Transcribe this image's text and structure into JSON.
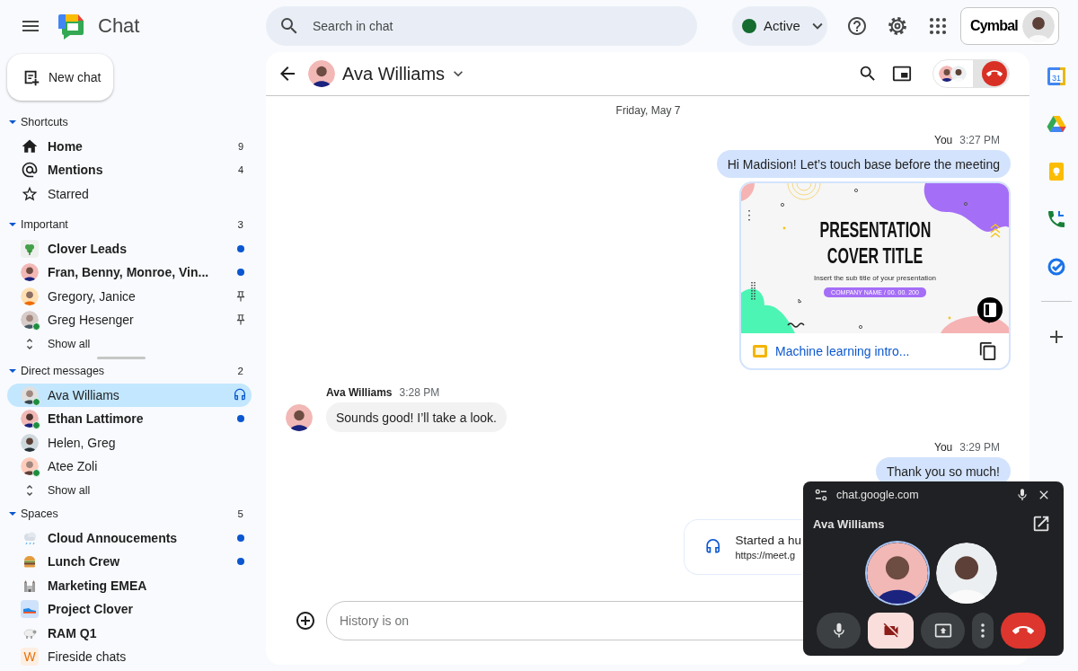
{
  "app": {
    "title": "Chat"
  },
  "search": {
    "placeholder": "Search in chat"
  },
  "status": {
    "label": "Active"
  },
  "account": {
    "brand": "Cymbal"
  },
  "new_chat": {
    "label": "New chat"
  },
  "sidebar": {
    "sections": [
      {
        "title": "Shortcuts",
        "expanded": true,
        "items": [
          {
            "kind": "home",
            "label": "Home",
            "unread": true,
            "count": "9",
            "notification": false,
            "pinned": false,
            "in_call": false,
            "online": false,
            "selected": false
          },
          {
            "kind": "mention",
            "label": "Mentions",
            "unread": true,
            "count": "4",
            "notification": false,
            "pinned": false,
            "in_call": false,
            "online": false,
            "selected": false
          },
          {
            "kind": "starred",
            "label": "Starred",
            "unread": false,
            "notification": false,
            "pinned": false,
            "in_call": false,
            "online": false,
            "selected": false
          }
        ]
      },
      {
        "title": "Important",
        "count": "3",
        "expanded": true,
        "items": [
          {
            "kind": "clover",
            "label": "Clover Leads",
            "unread": true,
            "notification": true,
            "pinned": false,
            "in_call": false,
            "online": false,
            "selected": false
          },
          {
            "kind": "person",
            "label": "Fran, Benny, Monroe, Vin...",
            "unread": true,
            "notification": true,
            "pinned": false,
            "in_call": false,
            "online": false,
            "selected": false
          },
          {
            "kind": "person",
            "label": "Gregory, Janice",
            "unread": false,
            "notification": false,
            "pinned": true,
            "in_call": false,
            "online": false,
            "selected": false
          },
          {
            "kind": "person",
            "label": "Greg Hesenger",
            "unread": false,
            "notification": false,
            "pinned": true,
            "in_call": false,
            "online": true,
            "selected": false
          },
          {
            "kind": "show_all",
            "label": "Show all"
          }
        ]
      },
      {
        "title": "Direct messages",
        "count": "2",
        "expanded": true,
        "items": [
          {
            "kind": "person",
            "label": "Ava Williams",
            "unread": false,
            "notification": false,
            "pinned": false,
            "in_call": true,
            "online": true,
            "selected": true
          },
          {
            "kind": "person",
            "label": "Ethan Lattimore",
            "unread": true,
            "notification": true,
            "pinned": false,
            "in_call": false,
            "online": true,
            "selected": false
          },
          {
            "kind": "person",
            "label": "Helen, Greg",
            "unread": false,
            "notification": false,
            "pinned": false,
            "in_call": false,
            "online": false,
            "selected": false
          },
          {
            "kind": "person",
            "label": "Atee Zoli",
            "unread": false,
            "notification": false,
            "pinned": false,
            "in_call": false,
            "online": true,
            "selected": false
          },
          {
            "kind": "show_all",
            "label": "Show all"
          }
        ]
      },
      {
        "title": "Spaces",
        "count": "5",
        "expanded": true,
        "items": [
          {
            "kind": "cloud",
            "label": "Cloud Annoucements",
            "unread": true,
            "notification": true,
            "pinned": false,
            "in_call": false,
            "online": false,
            "selected": false
          },
          {
            "kind": "burger",
            "label": "Lunch Crew",
            "unread": true,
            "notification": true,
            "pinned": false,
            "in_call": false,
            "online": false,
            "selected": false
          },
          {
            "kind": "castle",
            "label": "Marketing EMEA",
            "unread": true,
            "notification": false,
            "pinned": false,
            "in_call": false,
            "online": false,
            "selected": false
          },
          {
            "kind": "shoe",
            "label": "Project Clover",
            "unread": true,
            "notification": false,
            "pinned": false,
            "in_call": false,
            "online": false,
            "selected": false
          },
          {
            "kind": "sheep",
            "label": "RAM Q1",
            "unread": true,
            "notification": false,
            "pinned": false,
            "in_call": false,
            "online": false,
            "selected": false
          },
          {
            "kind": "letter",
            "letter": "W",
            "label": "Fireside chats",
            "unread": false,
            "notification": false,
            "pinned": false,
            "in_call": false,
            "online": false,
            "selected": false
          }
        ]
      }
    ]
  },
  "chat": {
    "title": "Ava Williams",
    "date": "Friday, May 7",
    "messages": [
      {
        "kind": "text",
        "mine": true,
        "sender": "You",
        "time": "3:27 PM",
        "text": "Hi Madision! Let’s touch base before the meeting"
      },
      {
        "kind": "attachment",
        "mine": true,
        "slide": {
          "title_line_1": "PRESENTATION",
          "title_line_2": "COVER TITLE",
          "subtitle": "Insert the sub title of your presentation",
          "footer": "COMPANY NAME / 00. 00. 200"
        },
        "file": "Machine learning intro..."
      },
      {
        "kind": "text",
        "mine": false,
        "sender": "Ava Williams",
        "time": "3:28 PM",
        "text": "Sounds good! I’ll take a look."
      },
      {
        "kind": "text",
        "mine": true,
        "sender": "You",
        "time": "3:29 PM",
        "text": "Thank you so much!"
      },
      {
        "kind": "call",
        "mine": true,
        "text": "Started a hu",
        "link": "https://meet.g"
      }
    ],
    "composer": {
      "placeholder": "History is on"
    }
  },
  "call_window": {
    "site": "chat.google.com",
    "title": "Ava Williams",
    "participants": [
      {
        "speaking": true
      },
      {
        "speaking": false
      }
    ],
    "controls": [
      {
        "kind": "mic",
        "on": true
      },
      {
        "kind": "camera",
        "on": false
      },
      {
        "kind": "present"
      },
      {
        "kind": "more"
      },
      {
        "kind": "hangup"
      }
    ]
  },
  "rail": [
    {
      "kind": "calendar",
      "text": "31"
    },
    {
      "kind": "drive"
    },
    {
      "kind": "keep"
    },
    {
      "kind": "phone"
    },
    {
      "kind": "tasks"
    },
    {
      "kind": "add"
    }
  ]
}
